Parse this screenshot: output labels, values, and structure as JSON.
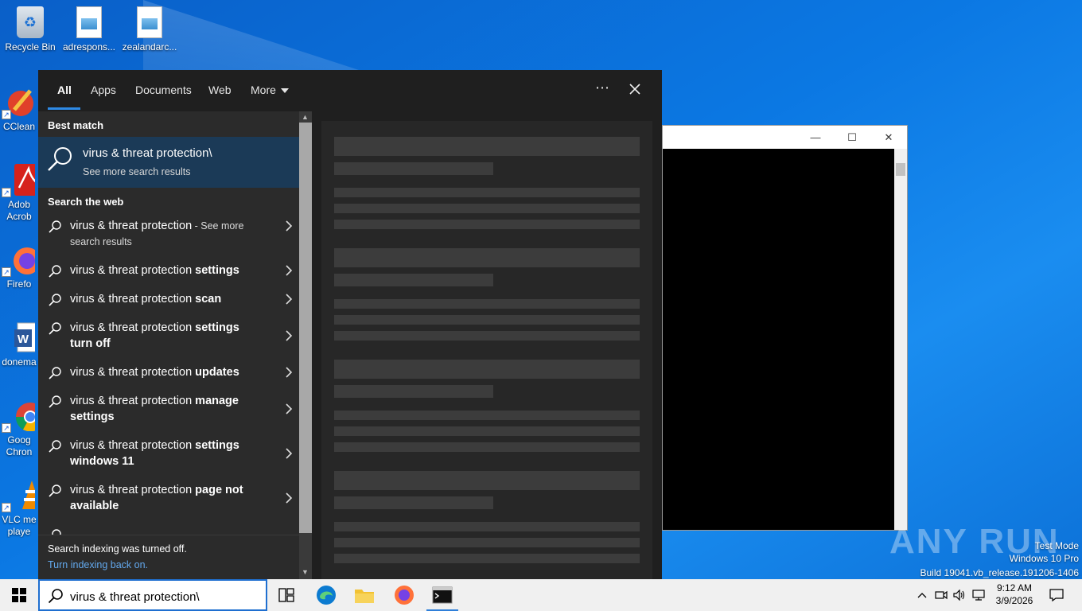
{
  "desktop": {
    "icons": [
      {
        "label": "Recycle Bin"
      },
      {
        "label": "adrespons..."
      },
      {
        "label": "zealandarc..."
      },
      {
        "label": "CClean"
      },
      {
        "label": "Adob\nAcrob"
      },
      {
        "label": "Firefo"
      },
      {
        "label": "donema"
      },
      {
        "label": "Goog\nChron"
      },
      {
        "label": "VLC me\nplaye"
      }
    ]
  },
  "console": {
    "minimize": "—",
    "maximize": "☐",
    "close": "✕"
  },
  "search": {
    "tabs": [
      "All",
      "Apps",
      "Documents",
      "Web",
      "More"
    ],
    "active_tab": "All",
    "more_menu": "⋯",
    "best_match_heading": "Best match",
    "best_match": {
      "title": "virus & threat protection\\",
      "subtitle": "See more search results"
    },
    "web_heading": "Search the web",
    "web_results": [
      {
        "prefix": "virus & threat protection",
        "bold": "",
        "suffix": " - See more",
        "line2": "search results"
      },
      {
        "prefix": "virus & threat protection ",
        "bold": "settings",
        "suffix": "",
        "line2": ""
      },
      {
        "prefix": "virus & threat protection ",
        "bold": "scan",
        "suffix": "",
        "line2": ""
      },
      {
        "prefix": "virus & threat protection ",
        "bold": "settings",
        "suffix": "",
        "line2": "turn off"
      },
      {
        "prefix": "virus & threat protection ",
        "bold": "updates",
        "suffix": "",
        "line2": ""
      },
      {
        "prefix": "virus & threat protection ",
        "bold": "manage",
        "suffix": "",
        "line2": "settings"
      },
      {
        "prefix": "virus & threat protection ",
        "bold": "settings",
        "suffix": "",
        "line2": "windows 11"
      },
      {
        "prefix": "virus & threat protection ",
        "bold": "page not",
        "suffix": "",
        "line2": "available"
      }
    ],
    "footer_text": "Search indexing was turned off.",
    "footer_link": "Turn indexing back on."
  },
  "taskbar": {
    "search_value": "virus & threat protection\\",
    "clock_time": "9:12 AM",
    "clock_date": "3/9/2026"
  },
  "watermark": {
    "brand": "ANY RUN",
    "line1": "Test Mode",
    "line2": "Windows 10 Pro",
    "line3": "Build 19041.vb_release.191206-1406"
  },
  "colors": {
    "accent": "#2e8ae6",
    "best_match_bg": "#1b3a57",
    "link": "#63a9ee"
  }
}
